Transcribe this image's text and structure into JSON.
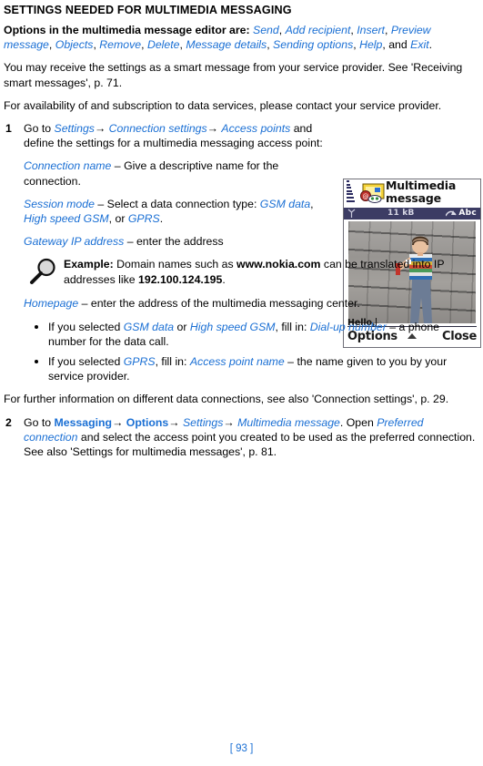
{
  "document": {
    "section_title": "SETTINGS NEEDED FOR MULTIMEDIA MESSAGING",
    "page_number": "[ 93 ]",
    "accent_color": "#1a6fd4"
  },
  "intro": {
    "lead_label": "Options in the multimedia message editor are:",
    "options": [
      "Send",
      "Add recipient",
      "Insert",
      "Preview message",
      "Objects",
      "Remove",
      "Delete",
      "Message details",
      "Sending options",
      "Help",
      "Exit"
    ],
    "options_sep": ", ",
    "options_and": ", and ",
    "options_end": ".",
    "paragraph_1": "You may receive the settings as a smart message from your service provider. See 'Receiving smart messages', p. 71.",
    "paragraph_2": "For availability of and subscription to data services, please contact your service provider."
  },
  "step1": {
    "number": "1",
    "goto_label": "Go to ",
    "path": [
      "Settings",
      "Connection settings",
      "Access points"
    ],
    "arrow": "→",
    "after_path": "and define the settings for a multimedia messaging access point:",
    "fields": [
      {
        "name": "Connection name",
        "dash": " – ",
        "desc": "Give a descriptive name for the connection."
      },
      {
        "name": "Session mode",
        "dash": " – ",
        "desc": "Select a data connection type: ",
        "values": [
          "GSM data",
          "High speed GSM",
          "GPRS"
        ],
        "values_sep": ", ",
        "values_or": ", or ",
        "desc_end": "."
      },
      {
        "name": "Gateway IP address",
        "dash": " – ",
        "desc": "enter the address"
      }
    ],
    "example": {
      "icon": "magnifier-icon",
      "label": "Example:",
      "text_1": " Domain names such as ",
      "domain": "www.nokia.com",
      "text_2": " can be translated into IP addresses like ",
      "ip": "192.100.124.195",
      "text_3": "."
    },
    "homepage": {
      "name": "Homepage",
      "dash": " – ",
      "desc": "enter the address of the multimedia messaging center."
    },
    "bullets": [
      {
        "text_1": "If you selected ",
        "link_1": "GSM data",
        "text_2": " or ",
        "link_2": "High speed GSM",
        "text_3": ", fill in: ",
        "link_3": "Dial-up number",
        "text_4": " – a phone number for the data call."
      },
      {
        "text_1": "If you selected ",
        "link_1": "GPRS",
        "text_2": ", fill in: ",
        "link_2": "Access point name",
        "text_3": " – the name given to you by your service provider."
      }
    ],
    "closing": "For further information on different data connections, see also 'Connection settings', p. 29."
  },
  "step2": {
    "number": "2",
    "goto_label": "Go to ",
    "path_bold": [
      "Messaging",
      "Options"
    ],
    "path_italic": [
      "Settings",
      "Multimedia message"
    ],
    "arrow": "→",
    "after_path": ". Open ",
    "preferred": "Preferred connection",
    "tail": " and select the access point you created to be used as the preferred connection. See also 'Settings for multimedia messages', p. 81."
  },
  "phone_screenshot": {
    "title_line1": "Multimedia",
    "title_line2": "message",
    "status_size": "11 kB",
    "status_input_mode": "Abc",
    "message_text": "Hello,",
    "softkey_left": "Options",
    "softkey_right": "Close",
    "icons": {
      "signal": "signal-bars-icon",
      "mms": "mms-envelope-icon",
      "antenna": "antenna-icon",
      "input_mode": "input-mode-icon",
      "scroll": "scroll-up-arrow-icon"
    },
    "colors": {
      "status_bar": "#3c3c64",
      "frame": "#6f6f78"
    }
  }
}
